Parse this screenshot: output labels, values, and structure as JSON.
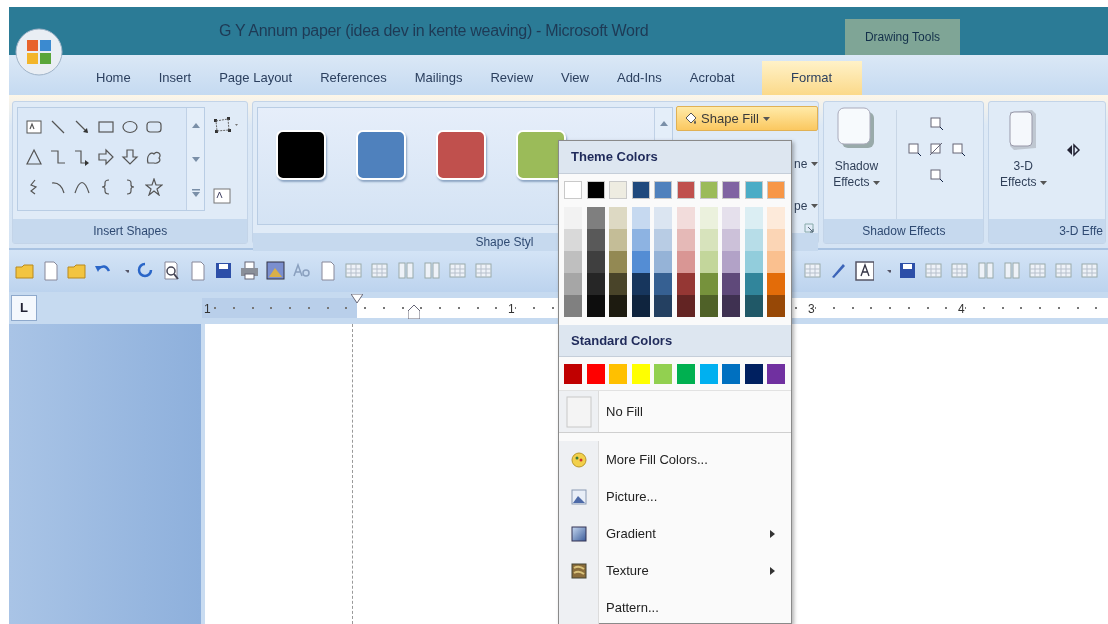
{
  "window": {
    "title": "G Y Annum paper (idea dev in kente weaving) - Microsoft Word",
    "context_group": "Drawing Tools"
  },
  "tabs": [
    {
      "label": "Home",
      "selected": false
    },
    {
      "label": "Insert",
      "selected": false
    },
    {
      "label": "Page Layout",
      "selected": false
    },
    {
      "label": "References",
      "selected": false
    },
    {
      "label": "Mailings",
      "selected": false
    },
    {
      "label": "Review",
      "selected": false
    },
    {
      "label": "View",
      "selected": false
    },
    {
      "label": "Add-Ins",
      "selected": false
    },
    {
      "label": "Acrobat",
      "selected": false
    },
    {
      "label": "Format",
      "selected": true
    }
  ],
  "insert_shapes": {
    "label": "Insert Shapes"
  },
  "shape_styles": {
    "label": "Shape Styl",
    "swatches": [
      {
        "color": "#000000"
      },
      {
        "color": "#4f81bd"
      },
      {
        "color": "#c0504d"
      },
      {
        "color": "#9bbb59"
      }
    ],
    "shape_fill": {
      "label": "Shape Fill",
      "expanded": true
    },
    "shape_outline": {
      "label": "ne"
    },
    "change_shape": {
      "label": "pe"
    }
  },
  "shadow_effects": {
    "label": "Shadow Effects",
    "button": "Shadow Effects"
  },
  "effects_3d": {
    "label": "3-D Effe",
    "button": "3-D Effects"
  },
  "ruler": {
    "tab_selector": "L",
    "labels": [
      "1",
      "1",
      "3",
      "4"
    ]
  },
  "shape_fill_menu": {
    "theme_heading": "Theme Colors",
    "theme_colors": [
      {
        "color": "#ffffff",
        "shades": [
          {
            "color": "#f2f2f2"
          },
          {
            "color": "#d9d9d9"
          },
          {
            "color": "#bfbfbf"
          },
          {
            "color": "#a6a6a6"
          },
          {
            "color": "#808080"
          }
        ]
      },
      {
        "color": "#000000",
        "shades": [
          {
            "color": "#7f7f7f"
          },
          {
            "color": "#595959"
          },
          {
            "color": "#3f3f3f"
          },
          {
            "color": "#262626"
          },
          {
            "color": "#0d0d0d"
          }
        ]
      },
      {
        "color": "#eeece1",
        "shades": [
          {
            "color": "#ddd9c3"
          },
          {
            "color": "#c4bd97"
          },
          {
            "color": "#938953"
          },
          {
            "color": "#494429"
          },
          {
            "color": "#1d1b10"
          }
        ]
      },
      {
        "color": "#1f497d",
        "shades": [
          {
            "color": "#c6d9f0"
          },
          {
            "color": "#8db3e2"
          },
          {
            "color": "#548dd4"
          },
          {
            "color": "#17365d"
          },
          {
            "color": "#0f243e"
          }
        ]
      },
      {
        "color": "#4f81bd",
        "shades": [
          {
            "color": "#dbe5f1"
          },
          {
            "color": "#b8cce4"
          },
          {
            "color": "#95b3d7"
          },
          {
            "color": "#366092"
          },
          {
            "color": "#244061"
          }
        ]
      },
      {
        "color": "#c0504d",
        "shades": [
          {
            "color": "#f2dcdb"
          },
          {
            "color": "#e5b9b7"
          },
          {
            "color": "#d99694"
          },
          {
            "color": "#953734"
          },
          {
            "color": "#632423"
          }
        ]
      },
      {
        "color": "#9bbb59",
        "shades": [
          {
            "color": "#ebf1dd"
          },
          {
            "color": "#d7e3bc"
          },
          {
            "color": "#c3d69b"
          },
          {
            "color": "#76923c"
          },
          {
            "color": "#4f6128"
          }
        ]
      },
      {
        "color": "#8064a2",
        "shades": [
          {
            "color": "#e5e0ec"
          },
          {
            "color": "#ccc1d9"
          },
          {
            "color": "#b2a2c7"
          },
          {
            "color": "#5f497a"
          },
          {
            "color": "#3f3151"
          }
        ]
      },
      {
        "color": "#4bacc6",
        "shades": [
          {
            "color": "#dbeef3"
          },
          {
            "color": "#b7dde8"
          },
          {
            "color": "#92cddc"
          },
          {
            "color": "#31859b"
          },
          {
            "color": "#205867"
          }
        ]
      },
      {
        "color": "#f79646",
        "shades": [
          {
            "color": "#fdeada"
          },
          {
            "color": "#fbd5b5"
          },
          {
            "color": "#fac08f"
          },
          {
            "color": "#e36c09"
          },
          {
            "color": "#974806"
          }
        ]
      }
    ],
    "standard_heading": "Standard Colors",
    "standard_colors": [
      {
        "color": "#c00000"
      },
      {
        "color": "#ff0000"
      },
      {
        "color": "#ffc000"
      },
      {
        "color": "#ffff00"
      },
      {
        "color": "#92d050"
      },
      {
        "color": "#00b050"
      },
      {
        "color": "#00b0f0"
      },
      {
        "color": "#0070c0"
      },
      {
        "color": "#002060"
      },
      {
        "color": "#7030a0"
      }
    ],
    "items": [
      {
        "label": "No Fill",
        "kind": "nofill",
        "submenu": false
      },
      {
        "label": "More Fill Colors...",
        "kind": "colors",
        "submenu": false
      },
      {
        "label": "Picture...",
        "kind": "picture",
        "submenu": false
      },
      {
        "label": "Gradient",
        "kind": "gradient",
        "submenu": true
      },
      {
        "label": "Texture",
        "kind": "texture",
        "submenu": true
      },
      {
        "label": "Pattern...",
        "kind": "pattern",
        "submenu": false
      }
    ]
  }
}
